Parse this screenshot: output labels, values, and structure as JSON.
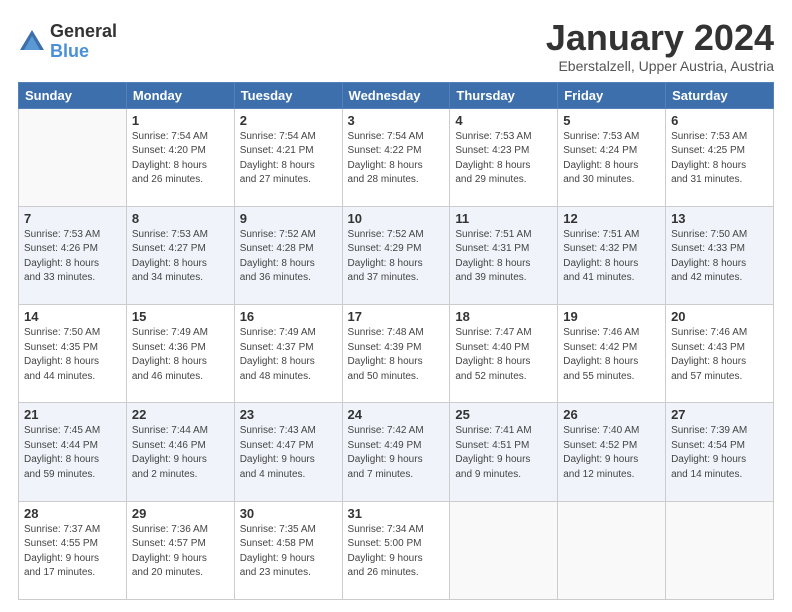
{
  "logo": {
    "general": "General",
    "blue": "Blue"
  },
  "title": "January 2024",
  "subtitle": "Eberstalzell, Upper Austria, Austria",
  "days_header": [
    "Sunday",
    "Monday",
    "Tuesday",
    "Wednesday",
    "Thursday",
    "Friday",
    "Saturday"
  ],
  "weeks": [
    [
      {
        "num": "",
        "info": ""
      },
      {
        "num": "1",
        "info": "Sunrise: 7:54 AM\nSunset: 4:20 PM\nDaylight: 8 hours\nand 26 minutes."
      },
      {
        "num": "2",
        "info": "Sunrise: 7:54 AM\nSunset: 4:21 PM\nDaylight: 8 hours\nand 27 minutes."
      },
      {
        "num": "3",
        "info": "Sunrise: 7:54 AM\nSunset: 4:22 PM\nDaylight: 8 hours\nand 28 minutes."
      },
      {
        "num": "4",
        "info": "Sunrise: 7:53 AM\nSunset: 4:23 PM\nDaylight: 8 hours\nand 29 minutes."
      },
      {
        "num": "5",
        "info": "Sunrise: 7:53 AM\nSunset: 4:24 PM\nDaylight: 8 hours\nand 30 minutes."
      },
      {
        "num": "6",
        "info": "Sunrise: 7:53 AM\nSunset: 4:25 PM\nDaylight: 8 hours\nand 31 minutes."
      }
    ],
    [
      {
        "num": "7",
        "info": "Sunrise: 7:53 AM\nSunset: 4:26 PM\nDaylight: 8 hours\nand 33 minutes."
      },
      {
        "num": "8",
        "info": "Sunrise: 7:53 AM\nSunset: 4:27 PM\nDaylight: 8 hours\nand 34 minutes."
      },
      {
        "num": "9",
        "info": "Sunrise: 7:52 AM\nSunset: 4:28 PM\nDaylight: 8 hours\nand 36 minutes."
      },
      {
        "num": "10",
        "info": "Sunrise: 7:52 AM\nSunset: 4:29 PM\nDaylight: 8 hours\nand 37 minutes."
      },
      {
        "num": "11",
        "info": "Sunrise: 7:51 AM\nSunset: 4:31 PM\nDaylight: 8 hours\nand 39 minutes."
      },
      {
        "num": "12",
        "info": "Sunrise: 7:51 AM\nSunset: 4:32 PM\nDaylight: 8 hours\nand 41 minutes."
      },
      {
        "num": "13",
        "info": "Sunrise: 7:50 AM\nSunset: 4:33 PM\nDaylight: 8 hours\nand 42 minutes."
      }
    ],
    [
      {
        "num": "14",
        "info": "Sunrise: 7:50 AM\nSunset: 4:35 PM\nDaylight: 8 hours\nand 44 minutes."
      },
      {
        "num": "15",
        "info": "Sunrise: 7:49 AM\nSunset: 4:36 PM\nDaylight: 8 hours\nand 46 minutes."
      },
      {
        "num": "16",
        "info": "Sunrise: 7:49 AM\nSunset: 4:37 PM\nDaylight: 8 hours\nand 48 minutes."
      },
      {
        "num": "17",
        "info": "Sunrise: 7:48 AM\nSunset: 4:39 PM\nDaylight: 8 hours\nand 50 minutes."
      },
      {
        "num": "18",
        "info": "Sunrise: 7:47 AM\nSunset: 4:40 PM\nDaylight: 8 hours\nand 52 minutes."
      },
      {
        "num": "19",
        "info": "Sunrise: 7:46 AM\nSunset: 4:42 PM\nDaylight: 8 hours\nand 55 minutes."
      },
      {
        "num": "20",
        "info": "Sunrise: 7:46 AM\nSunset: 4:43 PM\nDaylight: 8 hours\nand 57 minutes."
      }
    ],
    [
      {
        "num": "21",
        "info": "Sunrise: 7:45 AM\nSunset: 4:44 PM\nDaylight: 8 hours\nand 59 minutes."
      },
      {
        "num": "22",
        "info": "Sunrise: 7:44 AM\nSunset: 4:46 PM\nDaylight: 9 hours\nand 2 minutes."
      },
      {
        "num": "23",
        "info": "Sunrise: 7:43 AM\nSunset: 4:47 PM\nDaylight: 9 hours\nand 4 minutes."
      },
      {
        "num": "24",
        "info": "Sunrise: 7:42 AM\nSunset: 4:49 PM\nDaylight: 9 hours\nand 7 minutes."
      },
      {
        "num": "25",
        "info": "Sunrise: 7:41 AM\nSunset: 4:51 PM\nDaylight: 9 hours\nand 9 minutes."
      },
      {
        "num": "26",
        "info": "Sunrise: 7:40 AM\nSunset: 4:52 PM\nDaylight: 9 hours\nand 12 minutes."
      },
      {
        "num": "27",
        "info": "Sunrise: 7:39 AM\nSunset: 4:54 PM\nDaylight: 9 hours\nand 14 minutes."
      }
    ],
    [
      {
        "num": "28",
        "info": "Sunrise: 7:37 AM\nSunset: 4:55 PM\nDaylight: 9 hours\nand 17 minutes."
      },
      {
        "num": "29",
        "info": "Sunrise: 7:36 AM\nSunset: 4:57 PM\nDaylight: 9 hours\nand 20 minutes."
      },
      {
        "num": "30",
        "info": "Sunrise: 7:35 AM\nSunset: 4:58 PM\nDaylight: 9 hours\nand 23 minutes."
      },
      {
        "num": "31",
        "info": "Sunrise: 7:34 AM\nSunset: 5:00 PM\nDaylight: 9 hours\nand 26 minutes."
      },
      {
        "num": "",
        "info": ""
      },
      {
        "num": "",
        "info": ""
      },
      {
        "num": "",
        "info": ""
      }
    ]
  ]
}
